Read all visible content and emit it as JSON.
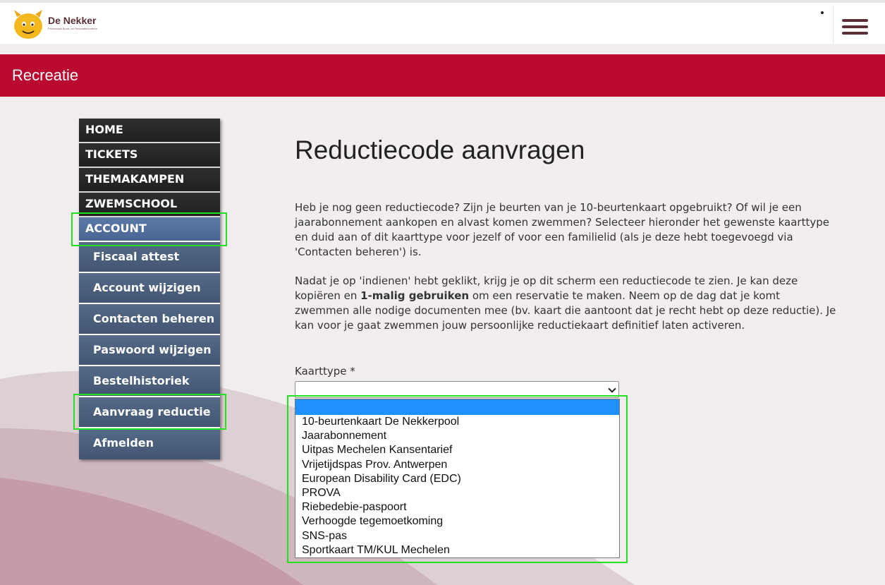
{
  "header": {
    "logo_name": "De Nekker",
    "logo_tagline": "Provinciaal Sport- en Recreatiecentrum",
    "menu_icon": "hamburger-menu-icon"
  },
  "banner": {
    "title": "Recreatie"
  },
  "sidebar": {
    "main_items": [
      {
        "label": "HOME"
      },
      {
        "label": "TICKETS"
      },
      {
        "label": "THEMAKAMPEN"
      },
      {
        "label": "ZWEMSCHOOL"
      },
      {
        "label": "ACCOUNT"
      }
    ],
    "sub_items": [
      {
        "label": "Fiscaal attest"
      },
      {
        "label": "Account wijzigen"
      },
      {
        "label": "Contacten beheren"
      },
      {
        "label": "Paswoord wijzigen"
      },
      {
        "label": "Bestelhistoriek"
      },
      {
        "label": "Aanvraag reductie"
      },
      {
        "label": "Afmelden"
      }
    ]
  },
  "main": {
    "title": "Reductiecode aanvragen",
    "paragraph1": "Heb je nog geen reductiecode? Zijn je beurten van je 10-beurtenkaart opgebruikt? Of wil je een jaarabonnement aankopen en alvast komen zwemmen? Selecteer hieronder het gewenste kaarttype en duid aan of dit kaarttype voor jezelf of voor een familielid (als je deze hebt toegevoegd via 'Contacten beheren') is.",
    "paragraph2_before": "Nadat je op 'indienen' hebt geklikt, krijg je op dit scherm een reductiecode te zien. Je kan deze kopiëren en ",
    "paragraph2_bold": "1-malig gebruiken",
    "paragraph2_after": " om een reservatie te maken. Neem op de dag dat je komt zwemmen alle nodige documenten mee (bv. kaart die aantoont dat je recht hebt op deze reductie). Je kan voor je gaat zwemmen jouw persoonlijke reductiekaart definitief laten activeren.",
    "field_label": "Kaarttype *",
    "select_value": "",
    "options": [
      "",
      "10-beurtenkaart De Nekkerpool",
      "Jaarabonnement",
      "Uitpas Mechelen Kansentarief",
      "Vrijetijdspas Prov. Antwerpen",
      "European Disability Card (EDC)",
      "PROVA",
      "Riebedebie-paspoort",
      "Verhoogde tegemoetkoming",
      "SNS-pas",
      "Sportkaart TM/KUL Mechelen"
    ]
  },
  "colors": {
    "banner": "#bb0a2f",
    "nav_dark": "#252525",
    "nav_active": "#5474a2",
    "nav_sub": "#4b5f7c",
    "option_selected": "#1e90ff",
    "highlight": "#22e022"
  }
}
